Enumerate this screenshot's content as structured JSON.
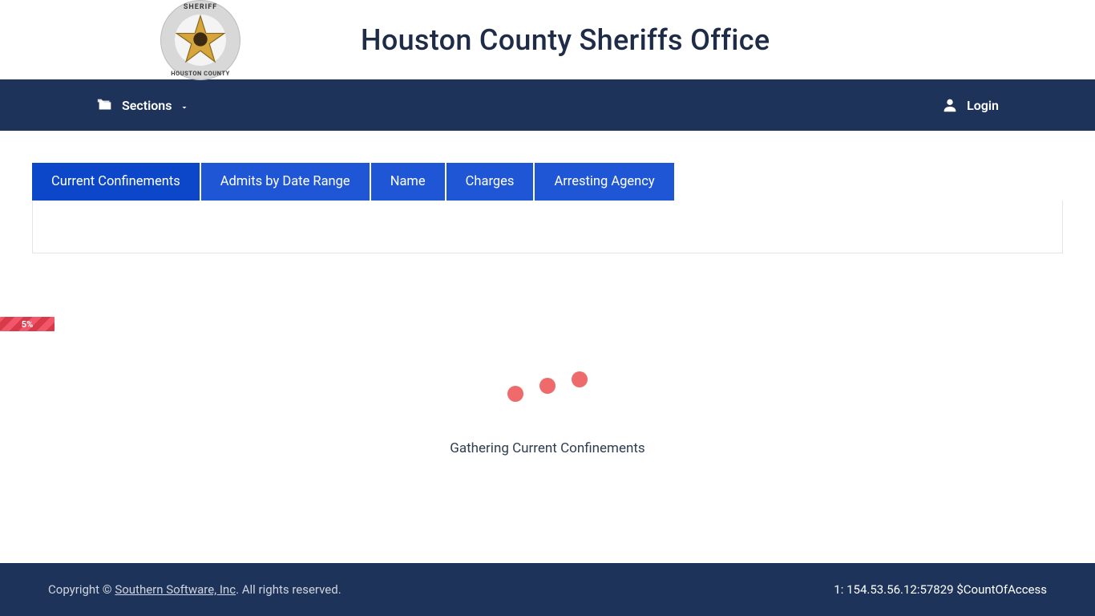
{
  "header": {
    "badge_top": "SHERIFF",
    "badge_bottom": "HOUSTON COUNTY",
    "title": "Houston County Sheriffs Office"
  },
  "navbar": {
    "sections_label": "Sections",
    "login_label": "Login"
  },
  "tabs": [
    {
      "label": "Current Confinements",
      "active": true
    },
    {
      "label": "Admits by Date Range",
      "active": false
    },
    {
      "label": "Name",
      "active": false
    },
    {
      "label": "Charges",
      "active": false
    },
    {
      "label": "Arresting Agency",
      "active": false
    }
  ],
  "progress": {
    "label": "5%"
  },
  "loader": {
    "message": "Gathering Current Confinements"
  },
  "footer": {
    "copyright_prefix": "Copyright © ",
    "vendor": "Southern Software, Inc",
    "copyright_suffix": ". All rights reserved.",
    "right": "1: 154.53.56.12:57829 $CountOfAccess"
  }
}
